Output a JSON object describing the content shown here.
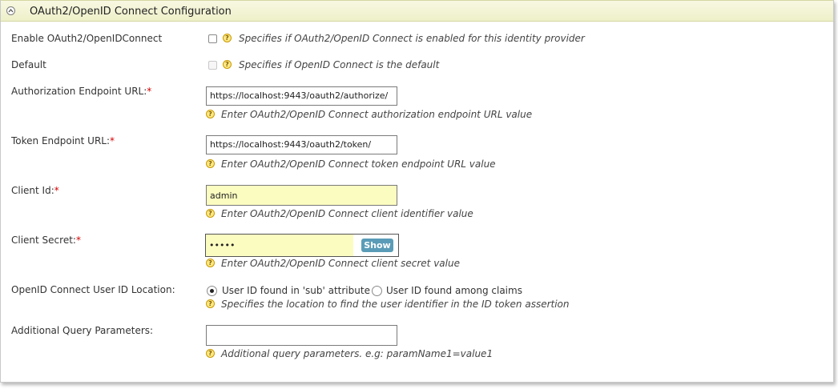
{
  "header": {
    "title": "OAuth2/OpenID Connect Configuration"
  },
  "enable": {
    "label": "Enable OAuth2/OpenIDConnect",
    "hint": "Specifies if OAuth2/OpenID Connect is enabled for this identity provider"
  },
  "default": {
    "label": "Default",
    "hint": "Specifies if OpenID Connect is the default"
  },
  "auth_endpoint": {
    "label": "Authorization Endpoint URL:",
    "required": "*",
    "value": "https://localhost:9443/oauth2/authorize/",
    "hint": "Enter OAuth2/OpenID Connect authorization endpoint URL value"
  },
  "token_endpoint": {
    "label": "Token Endpoint URL:",
    "required": "*",
    "value": "https://localhost:9443/oauth2/token/",
    "hint": "Enter OAuth2/OpenID Connect token endpoint URL value"
  },
  "client_id": {
    "label": "Client Id:",
    "required": "*",
    "value": "admin",
    "hint": "Enter OAuth2/OpenID Connect client identifier value"
  },
  "client_secret": {
    "label": "Client Secret:",
    "required": "*",
    "value": "•••••",
    "show_label": "Show",
    "hint": "Enter OAuth2/OpenID Connect client secret value"
  },
  "user_id_location": {
    "label": "OpenID Connect User ID Location:",
    "option_sub": "User ID found in 'sub' attribute",
    "option_claims": "User ID found among claims",
    "hint": "Specifies the location to find the user identifier in the ID token assertion"
  },
  "query_params": {
    "label": "Additional Query Parameters:",
    "value": "",
    "hint": "Additional query parameters. e.g: paramName1=value1"
  },
  "colors": {
    "header_bg": "#eef0c9",
    "required": "#d60000",
    "filled_input": "#fbfcc0",
    "show_button": "#5a9cb7"
  }
}
